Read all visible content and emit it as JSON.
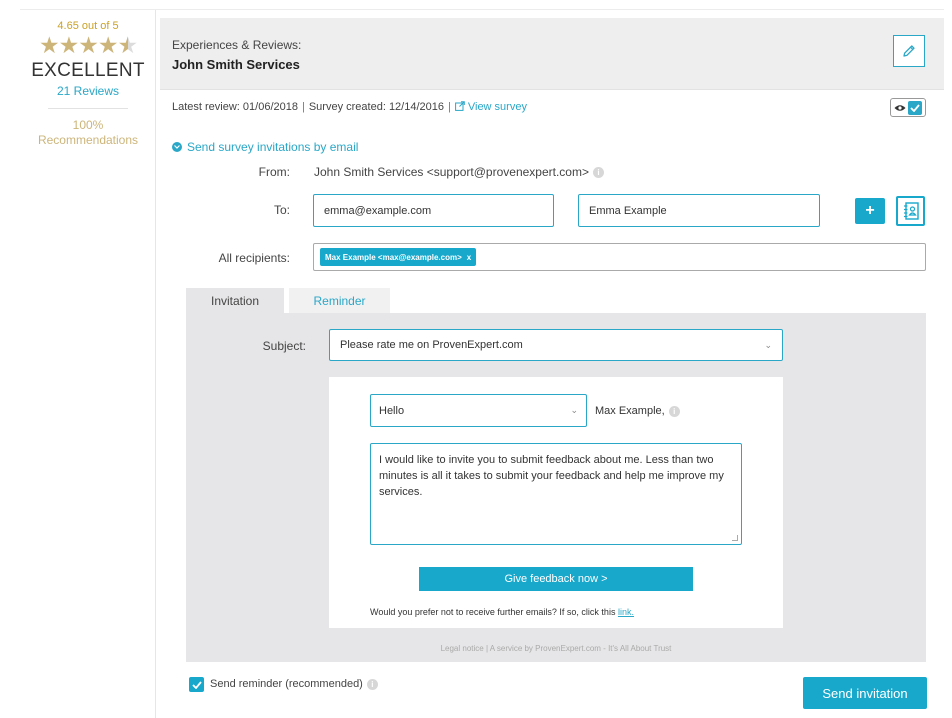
{
  "rating": {
    "score_text": "4.65 out of 5",
    "score": 4.65,
    "label": "EXCELLENT",
    "reviews_link": "21 Reviews",
    "recommend_percent": "100%",
    "recommend_label": "Recommendations",
    "star_color": "#cdb57a"
  },
  "header": {
    "subtitle": "Experiences & Reviews:",
    "title": "John Smith Services",
    "edit_icon": "pencil-icon"
  },
  "meta": {
    "latest_review": "Latest review: 01/06/2018",
    "separator": "|",
    "survey_created": "Survey created: 12/14/2016",
    "view_survey": "View survey"
  },
  "invite": {
    "section_title": "Send survey invitations by email",
    "from_label": "From:",
    "from_value": "John Smith Services <support@provenexpert.com>",
    "to_label": "To:",
    "to_email": "emma@example.com",
    "to_name": "Emma Example",
    "add_label": "+",
    "recipients_label": "All recipients:",
    "recipient_chip": "Max Example <max@example.com>",
    "chip_remove": "x"
  },
  "tabs": [
    {
      "label": "Invitation",
      "active": true
    },
    {
      "label": "Reminder",
      "active": false
    }
  ],
  "email": {
    "subject_label": "Subject:",
    "subject_value": "Please rate me on ProvenExpert.com",
    "greeting_value": "Hello",
    "greeting_name": "Max Example,",
    "message": "I would like to invite you to submit feedback about me. Less than two minutes is all it takes to submit your feedback and help me improve my services.",
    "feedback_button": "Give feedback now >",
    "unsubscribe_text": "Would you prefer not to receive further emails? If so, click this",
    "unsubscribe_link": "link.",
    "footer_legal": "Legal notice | A service by ProvenExpert.com - It's All About Trust"
  },
  "bottom": {
    "reminder_label": "Send reminder (recommended)",
    "send_button": "Send invitation"
  },
  "colors": {
    "accent": "#17a8cc",
    "link": "#2aa7c7",
    "gold": "#cdb57a"
  }
}
